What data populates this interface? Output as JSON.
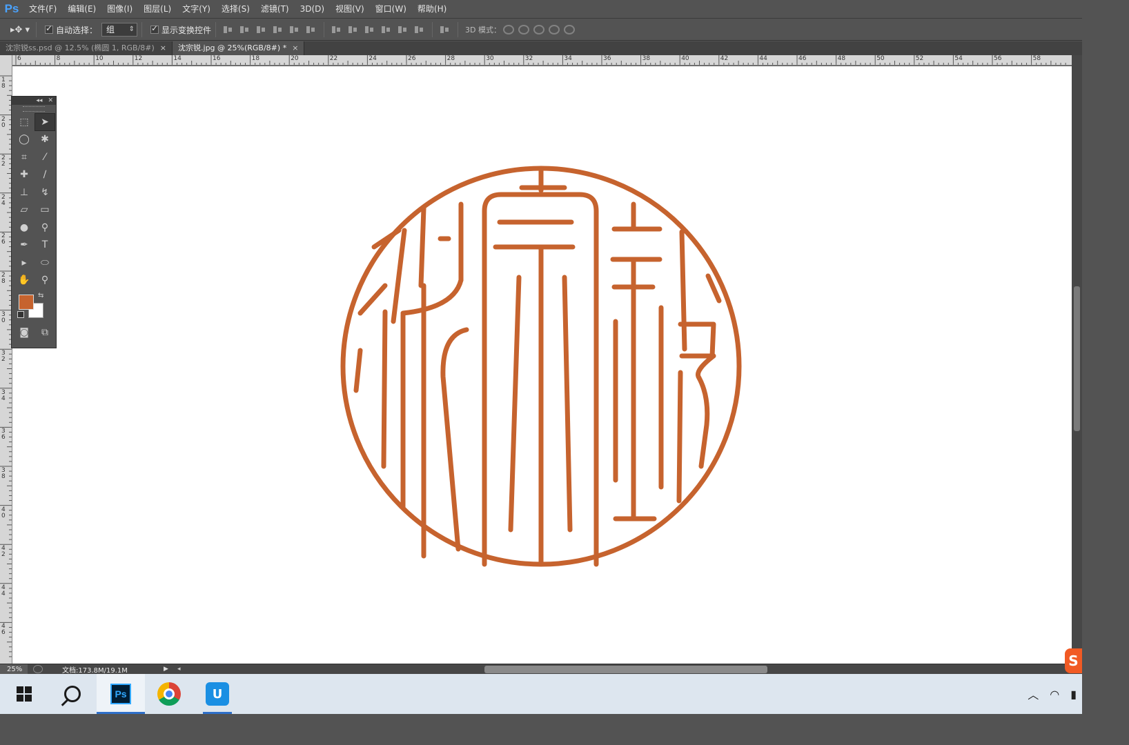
{
  "app": {
    "logo": "Ps"
  },
  "menu": {
    "items": [
      "文件(F)",
      "编辑(E)",
      "图像(I)",
      "图层(L)",
      "文字(Y)",
      "选择(S)",
      "滤镜(T)",
      "3D(D)",
      "视图(V)",
      "窗口(W)",
      "帮助(H)"
    ]
  },
  "options": {
    "auto_select_label": "自动选择：",
    "auto_select_value": "组",
    "show_transform_label": "显示变换控件",
    "mode3d_label": "3D 模式："
  },
  "tabs": [
    {
      "label": "沈宗锐ss.psd @ 12.5% (椭圆 1, RGB/8#)",
      "close": "×"
    },
    {
      "label": "沈宗锐.jpg @ 25%(RGB/8#) *",
      "close": "×"
    }
  ],
  "ruler": {
    "top_labels": [
      "6",
      "8",
      "10",
      "12",
      "14",
      "16",
      "18",
      "20",
      "22",
      "24",
      "26",
      "28",
      "30",
      "32",
      "34",
      "36",
      "38",
      "40",
      "42",
      "44",
      "46",
      "48",
      "50",
      "52",
      "54",
      "56",
      "58"
    ],
    "left_labels": [
      "18",
      "20",
      "22",
      "24",
      "26",
      "28",
      "30",
      "32",
      "34",
      "36",
      "38",
      "40",
      "42",
      "44",
      "46"
    ]
  },
  "status": {
    "zoom": "25%",
    "doc_info": "文档:173.8M/19.1M"
  },
  "colors": {
    "foreground": "#c6632e",
    "background": "#ffffff",
    "seal": "#c6632e"
  },
  "taskbar": {
    "ps_label": "Ps",
    "app3_label": "U"
  },
  "tray": {
    "up_arrow": "︿"
  }
}
